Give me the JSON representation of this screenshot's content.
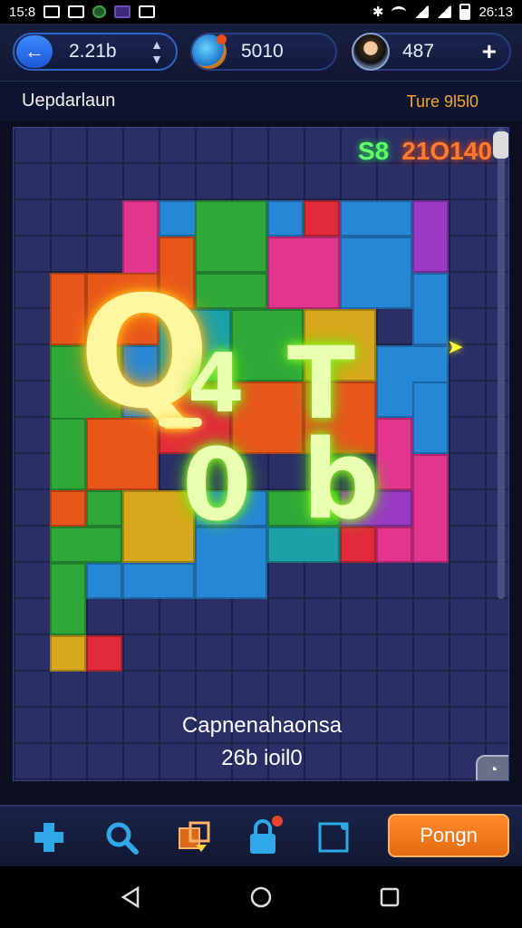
{
  "status_bar": {
    "time_left": "15:8",
    "time_right": "26:13"
  },
  "header": {
    "level_value": "2.21b",
    "coins_value": "5010",
    "gems_value": "487",
    "back_icon": "back-arrow-icon",
    "add_icon": "plus-icon"
  },
  "info": {
    "title": "Uepdarlaun",
    "right_text": "Ture 9l5l0"
  },
  "board": {
    "score_green": "S8",
    "score_orange": "21O140",
    "neon_q": "Q",
    "neon_4": "4",
    "neon_t": "T",
    "neon_0": "0",
    "neon_b": "b",
    "caption_line1": "Capnenahaonsa",
    "caption_line2": "26b ioil0",
    "colors": {
      "pink": "#e2358f",
      "orange": "#e8561c",
      "green": "#2fa83a",
      "blue": "#2687d6",
      "purple": "#9a3ac4",
      "yellow": "#d8a81c",
      "red": "#e22a3a",
      "teal": "#1aa2a8"
    }
  },
  "toolbar": {
    "play_label": "Pongn",
    "tools": [
      "puzzle-piece-icon",
      "magnify-icon",
      "edge-pieces-icon",
      "lock-icon",
      "frame-icon"
    ]
  },
  "nav": {
    "back": "back-triangle-icon",
    "home": "home-circle-icon",
    "recents": "recents-square-icon"
  }
}
